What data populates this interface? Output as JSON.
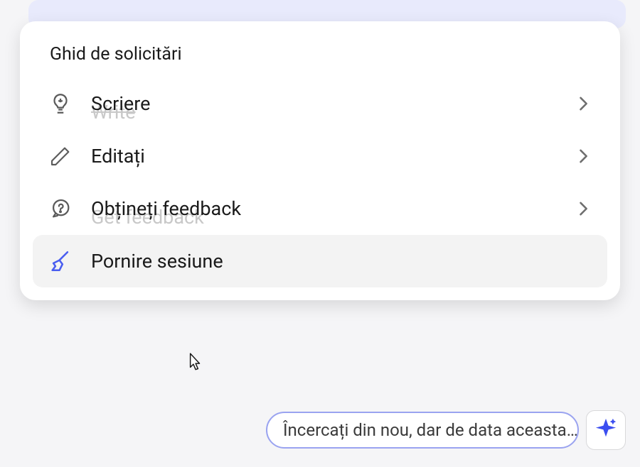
{
  "panel": {
    "title": "Ghid de solicitări",
    "items": [
      {
        "label": "Scriere",
        "ghost": "Write",
        "has_chevron": true
      },
      {
        "label": "Editați",
        "ghost": "",
        "has_chevron": true
      },
      {
        "label": "Obțineți feedback",
        "ghost": "Get feedback",
        "has_chevron": true
      },
      {
        "label": "Pornire sesiune",
        "ghost": "",
        "has_chevron": false,
        "hovered": true
      }
    ]
  },
  "suggestion": {
    "text": "Încercați din nou, dar de data aceasta…"
  },
  "colors": {
    "accent": "#4a5ef0",
    "icon_stroke": "#5b5b5b",
    "chevron": "#6e6e6e"
  }
}
